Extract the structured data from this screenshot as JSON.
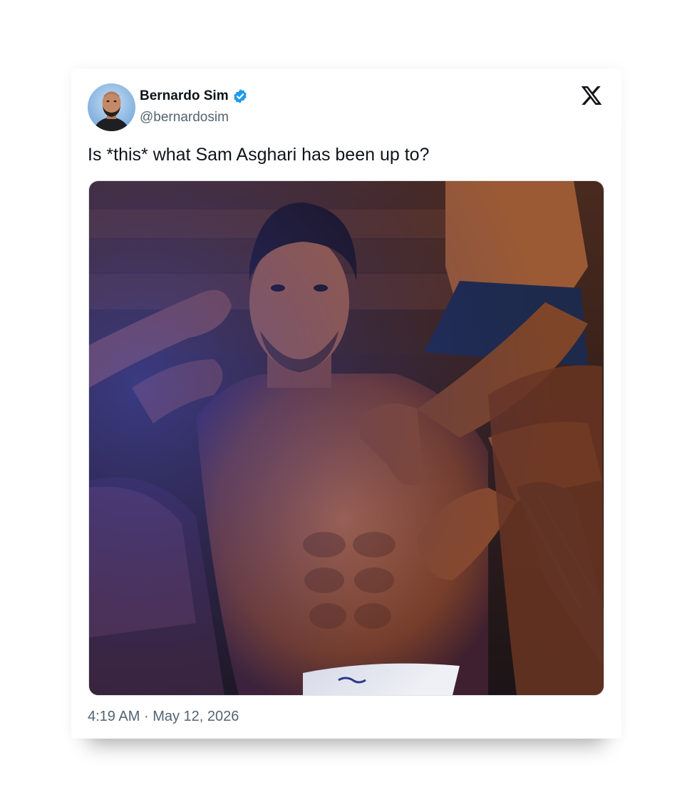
{
  "tweet": {
    "display_name": "Bernardo Sim",
    "handle": "@bernardosim",
    "text": "Is *this* what Sam Asghari has been up to?",
    "time": "4:19 AM",
    "separator": "·",
    "date": "May 12, 2026",
    "verified": true,
    "media_alt": "Sauna photo of a shirtless man with several hands resting on him"
  },
  "icons": {
    "verified": "verified-badge-icon",
    "brand": "x-logo-icon"
  },
  "colors": {
    "text_primary": "#0f1419",
    "text_secondary": "#536471",
    "verified_blue": "#1d9bf0"
  }
}
